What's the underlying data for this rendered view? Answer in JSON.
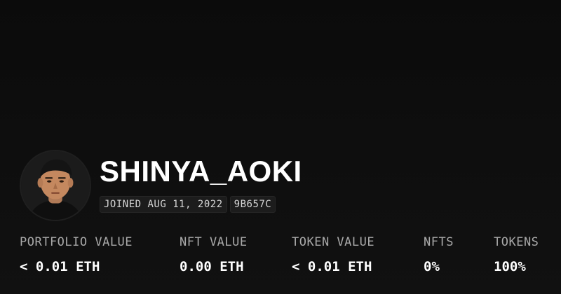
{
  "profile": {
    "avatar_icon": "user-portrait",
    "username": "SHINYA_AOKI",
    "joined": "JOINED AUG 11, 2022",
    "address": "9B657C"
  },
  "stats": [
    {
      "label": "PORTFOLIO VALUE",
      "value": "< 0.01 ETH"
    },
    {
      "label": "NFT VALUE",
      "value": "0.00 ETH"
    },
    {
      "label": "TOKEN VALUE",
      "value": "< 0.01 ETH"
    },
    {
      "label": "NFTS",
      "value": "0%"
    },
    {
      "label": "TOKENS",
      "value": "100%"
    }
  ],
  "colors": {
    "background": "#0b0b0b",
    "text": "#ffffff",
    "muted": "#a9a9a9",
    "tag_bg": "#1c1c1c"
  }
}
